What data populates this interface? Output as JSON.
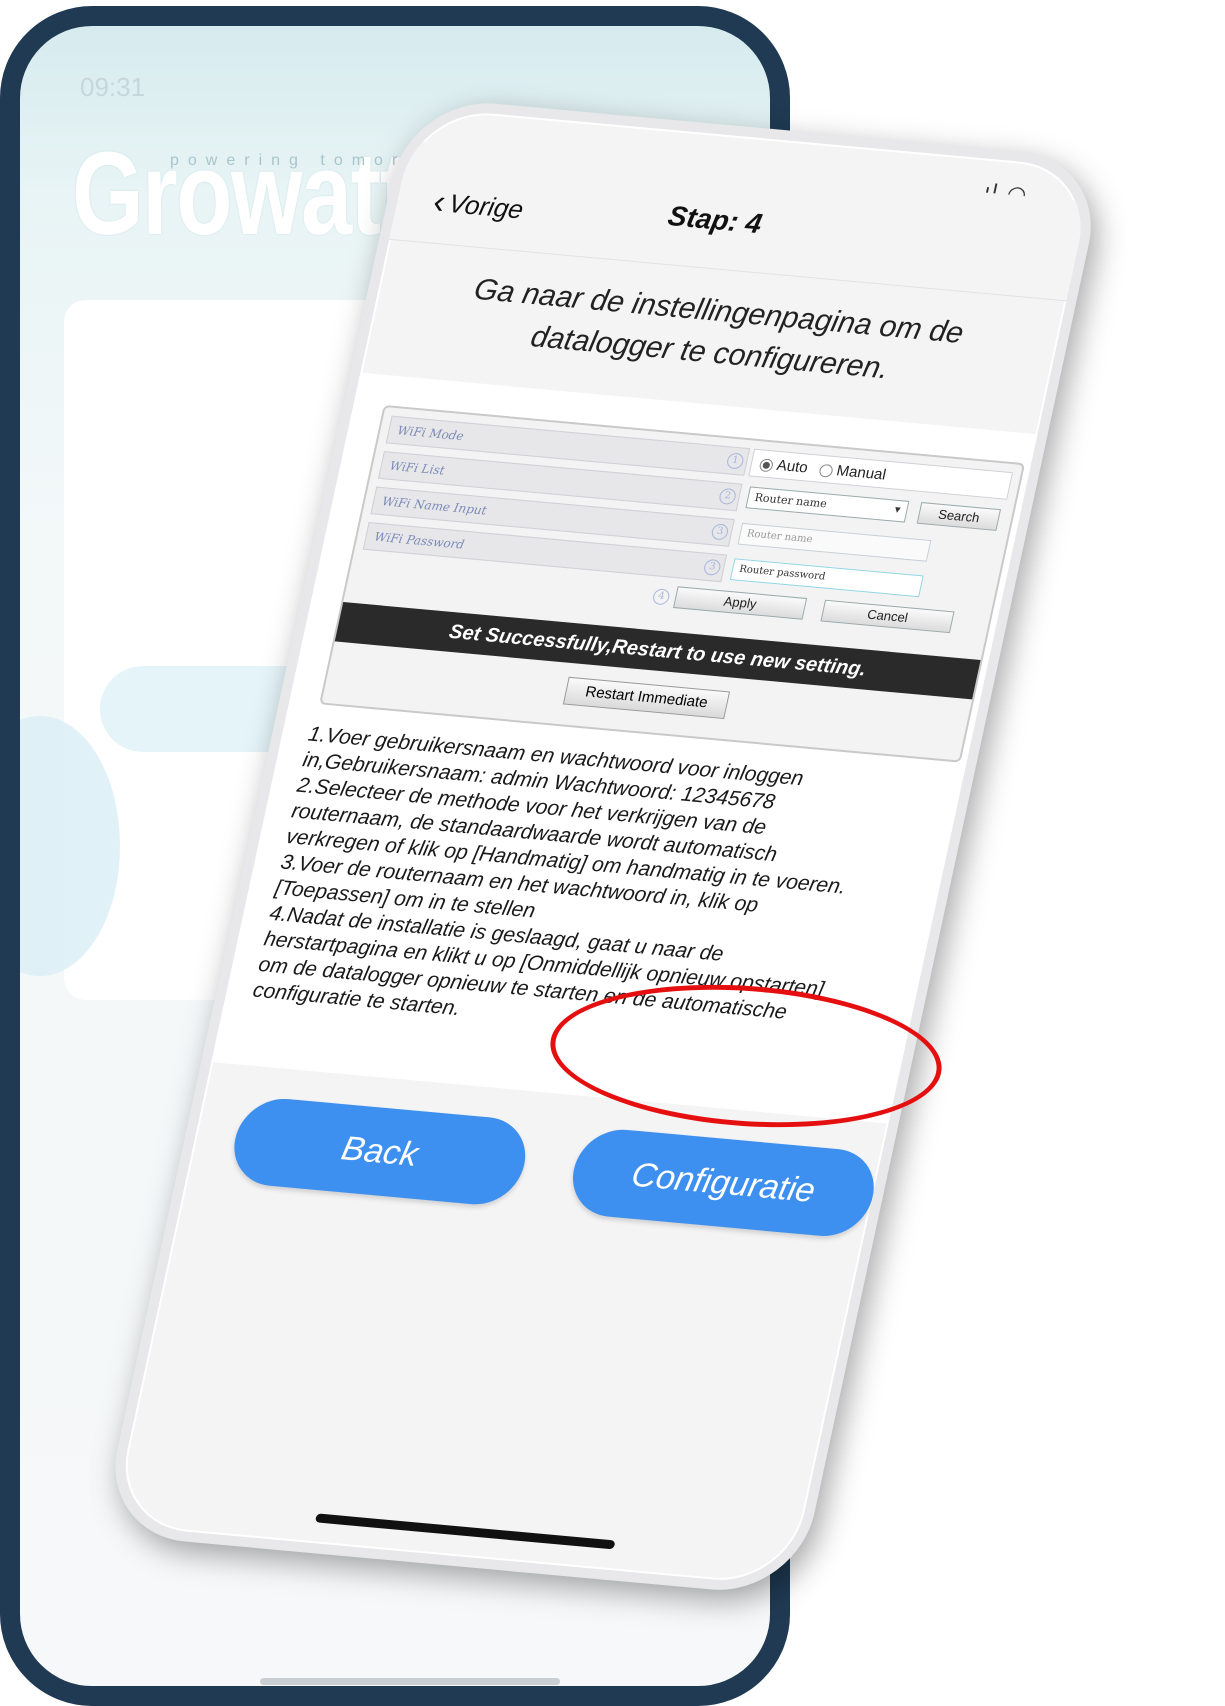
{
  "back_phone": {
    "time": "09:31",
    "logo": "Growatt",
    "tagline": "powering tomorrow"
  },
  "front_phone": {
    "status_icons": "signal wifi",
    "nav": {
      "back_label": "Vorige",
      "title": "Stap: 4"
    },
    "instruction": "Ga naar de instellingenpagina om de datalogger te configureren.",
    "settings_screenshot": {
      "rows": [
        {
          "label": "WiFi Mode",
          "info": "1"
        },
        {
          "label": "WiFi List",
          "info": "2"
        },
        {
          "label": "WiFi Name Input",
          "info": "3"
        },
        {
          "label": "WiFi Password",
          "info": "3"
        }
      ],
      "mode_auto": "Auto",
      "mode_manual": "Manual",
      "router_select": "Router name",
      "search_button": "Search",
      "name_placeholder": "Router name",
      "password_value": "Router password",
      "apply_info": "4",
      "apply_button": "Apply",
      "cancel_button": "Cancel",
      "success_message": "Set Successfully,Restart to use new setting.",
      "restart_button": "Restart Immediate"
    },
    "steps": [
      "1.Voer gebruikersnaam en wachtwoord voor inloggen",
      "in,Gebruikersnaam: admin Wachtwoord: 12345678",
      "2.Selecteer de methode voor het verkrijgen van de",
      "routernaam, de standaardwaarde wordt automatisch",
      "verkregen of klik op [Handmatig] om handmatig in te voeren.",
      "3.Voer de routernaam en het wachtwoord in, klik op",
      "[Toepassen] om in te stellen",
      "4.Nadat de installatie is geslaagd, gaat u naar de",
      "herstartpagina en klikt u op [Onmiddellijk opnieuw opstarten]",
      "om de datalogger opnieuw te starten en de automatische",
      "configuratie te starten."
    ],
    "back_button": "Back",
    "config_button": "Configuratie"
  },
  "colors": {
    "frame": "#1f3a52",
    "button_blue": "#3d90ef",
    "highlight_red": "#e60f0f"
  }
}
